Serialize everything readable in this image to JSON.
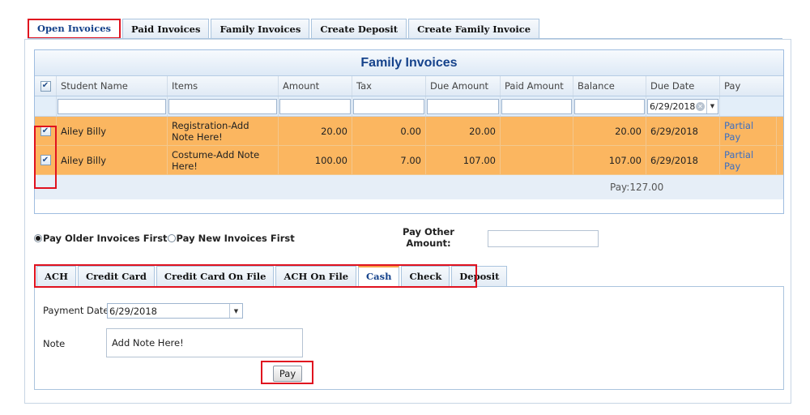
{
  "top_tabs": [
    "Open Invoices",
    "Paid Invoices",
    "Family Invoices",
    "Create Deposit",
    "Create Family Invoice"
  ],
  "grid": {
    "title": "Family Invoices",
    "columns": [
      "Student Name",
      "Items",
      "Amount",
      "Tax",
      "Due Amount",
      "Paid Amount",
      "Balance",
      "Due Date",
      "Pay"
    ],
    "filter_due_date": "6/29/2018",
    "rows": [
      {
        "student": "Ailey Billy",
        "items": "Registration-Add Note Here!",
        "amount": "20.00",
        "tax": "0.00",
        "due_amount": "20.00",
        "paid_amount": "",
        "balance": "20.00",
        "due_date": "6/29/2018",
        "pay": "Partial Pay"
      },
      {
        "student": "Ailey Billy",
        "items": "Costume-Add Note Here!",
        "amount": "100.00",
        "tax": "7.00",
        "due_amount": "107.00",
        "paid_amount": "",
        "balance": "107.00",
        "due_date": "6/29/2018",
        "pay": "Partial Pay"
      }
    ],
    "footer_total": "Pay:127.00"
  },
  "pay_order": {
    "older": "Pay Older Invoices First",
    "newer": "Pay New Invoices First"
  },
  "pay_other_label": "Pay Other Amount:",
  "pay_other_value": "",
  "payment_tabs": [
    "ACH",
    "Credit Card",
    "Credit Card On File",
    "ACH On File",
    "Cash",
    "Check",
    "Deposit"
  ],
  "payment_form": {
    "date_label": "Payment Date:",
    "date_value": "6/29/2018",
    "note_label": "Note",
    "note_value": "Add Note Here!",
    "pay_button": "Pay"
  },
  "colors": {
    "selected_row": "#fbb660",
    "title": "#15428b",
    "highlight": "#e0121f",
    "link": "#3b6fc4"
  }
}
